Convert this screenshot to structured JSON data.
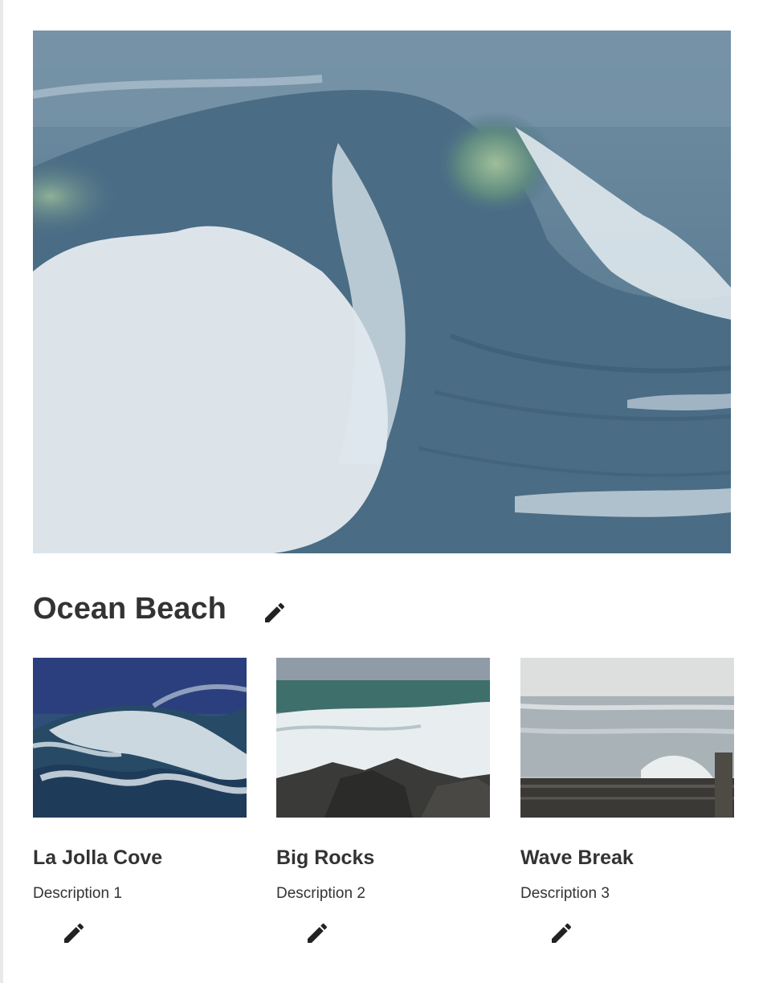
{
  "hero": {
    "image_alt": "Breaking ocean wave"
  },
  "header": {
    "title": "Ocean Beach",
    "edit_icon": "pencil-icon"
  },
  "cards": [
    {
      "name": "La Jolla Cove",
      "description": "Description 1",
      "image_alt": "Crashing wave on dark blue water",
      "edit_icon": "pencil-icon"
    },
    {
      "name": "Big Rocks",
      "description": "Description 2",
      "image_alt": "Surf breaking over dark rocks",
      "edit_icon": "pencil-icon"
    },
    {
      "name": "Wave Break",
      "description": "Description 3",
      "image_alt": "Silvery sea with rocky ledge",
      "edit_icon": "pencil-icon"
    }
  ],
  "colors": {
    "text": "#333333",
    "icon": "#222222",
    "sea_dark": "#3e5f78",
    "foam": "#eef3f6"
  }
}
